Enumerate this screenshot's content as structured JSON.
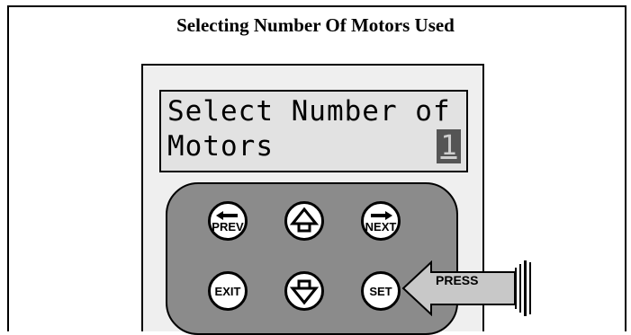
{
  "title": "Selecting Number Of Motors Used",
  "lcd": {
    "line1": "Select Number of",
    "line2": "Motors",
    "value": "1"
  },
  "keys": {
    "prev": "PREV",
    "up_icon": "up-arrow-icon",
    "next": "NEXT",
    "exit": "EXIT",
    "down_icon": "down-arrow-icon",
    "set": "SET"
  },
  "callout": {
    "label": "PRESS"
  },
  "colors": {
    "keypad": "#8b8b8b",
    "lcd_bg": "#e2e2e2",
    "cursor": "#555555",
    "callout": "#c8c8c8"
  }
}
